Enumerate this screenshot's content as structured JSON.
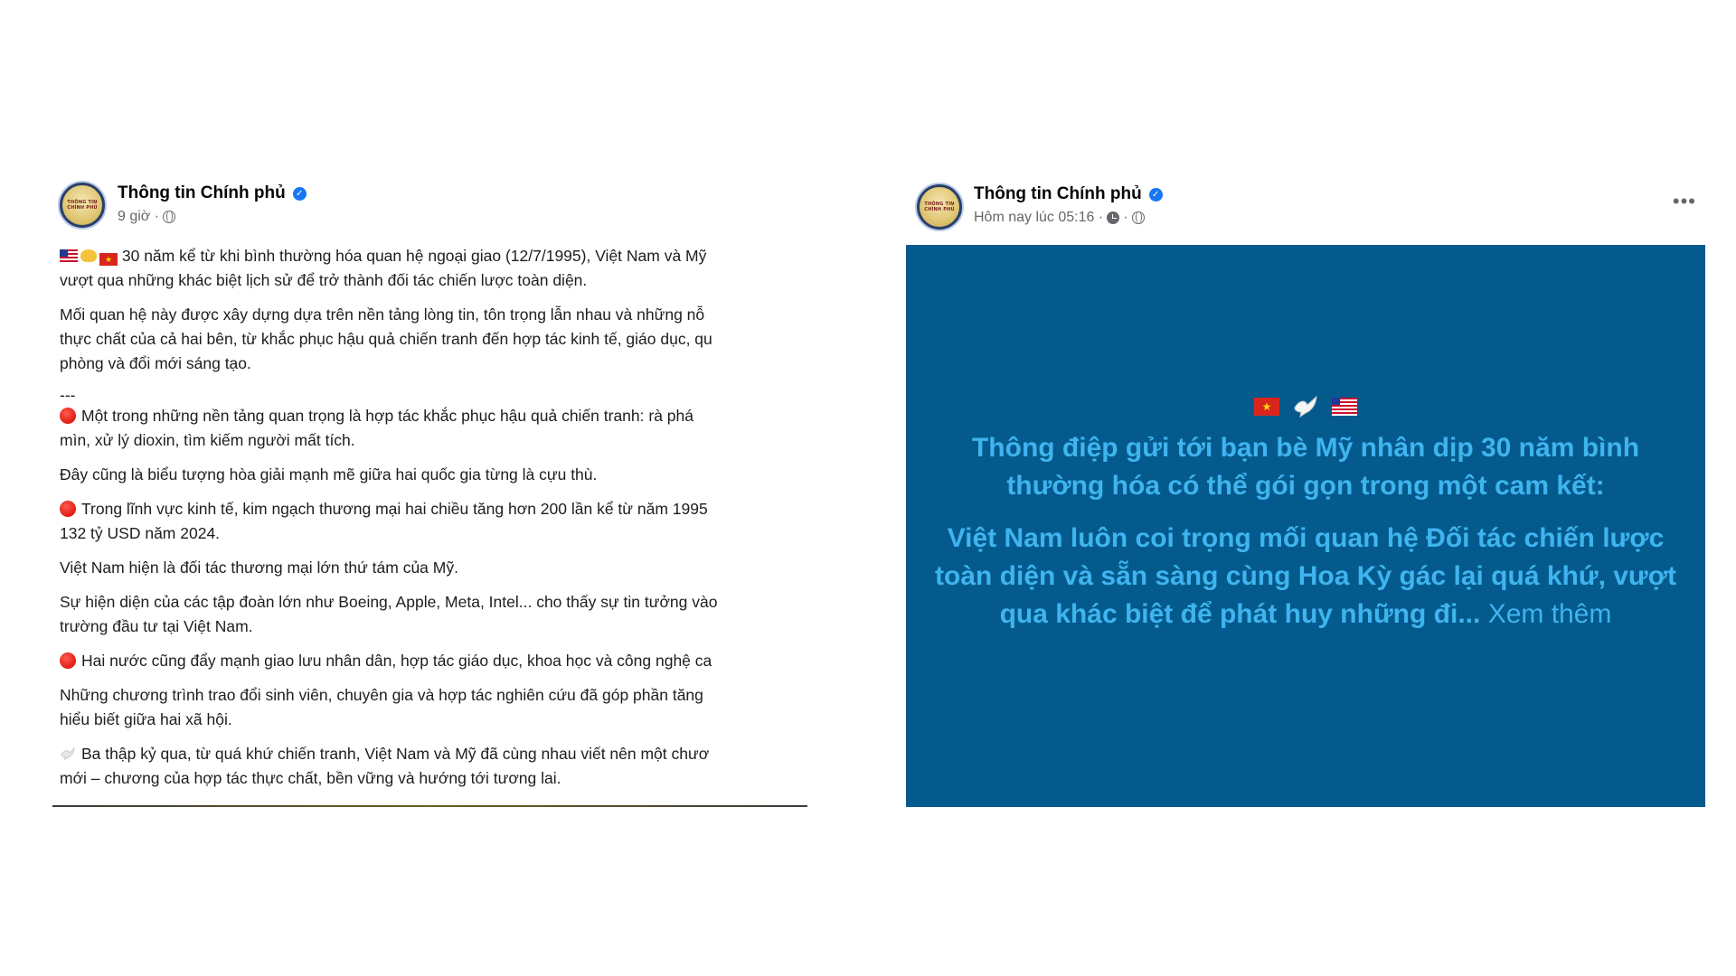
{
  "posts": [
    {
      "author": "Thông tin Chính phủ",
      "avatar_text": "THÔNG TIN CHÍNH PHỦ",
      "time": "9 giờ ·",
      "lines": {
        "l1": "30 năm kể từ khi bình thường hóa quan hệ ngoại giao (12/7/1995), Việt Nam và Mỹ",
        "l2": "vượt qua những khác biệt lịch sử để trở thành đối tác chiến lược toàn diện.",
        "l3": "Mối quan hệ này được xây dựng dựa trên nền tảng lòng tin, tôn trọng lẫn nhau và những nỗ",
        "l4": "thực chất của cả hai bên, từ khắc phục hậu quả chiến tranh đến hợp tác kinh tế, giáo dục, qu",
        "l5": "phòng và đổi mới sáng tạo.",
        "l6": "---",
        "l7": "Một trong những nền tảng quan trọng là hợp tác khắc phục hậu quả chiến tranh: rà phá",
        "l8": "mìn, xử lý dioxin, tìm kiếm người mất tích.",
        "l9": "Đây cũng là biểu tượng hòa giải mạnh mẽ giữa hai quốc gia từng là cựu thù.",
        "l10": "Trong lĩnh vực kinh tế, kim ngạch thương mại hai chiều tăng hơn 200 lần kể từ năm 1995",
        "l11": "132 tỷ USD năm 2024.",
        "l12": "Việt Nam hiện là đối tác thương mại lớn thứ tám của Mỹ.",
        "l13": "Sự hiện diện của các tập đoàn lớn như Boeing, Apple, Meta, Intel... cho thấy sự tin tưởng vào",
        "l14": "trường đầu tư tại Việt Nam.",
        "l15": "Hai nước cũng đẩy mạnh giao lưu nhân dân, hợp tác giáo dục, khoa học và công nghệ ca",
        "l16": "Những chương trình trao đổi sinh viên, chuyên gia và hợp tác nghiên cứu đã góp phần tăng",
        "l17": "hiểu biết giữa hai xã hội.",
        "l18": "Ba thập kỷ qua, từ quá khứ chiến tranh, Việt Nam và Mỹ đã cùng nhau viết nên một chươ",
        "l19": "mới – chương của hợp tác thực chất, bền vững và hướng tới tương lai."
      },
      "icons": [
        "us-flag",
        "handshake",
        "vietnam-flag",
        "red-circle",
        "dove",
        "globe"
      ]
    },
    {
      "author": "Thông tin Chính phủ",
      "avatar_text": "THÔNG TIN CHÍNH PHỦ",
      "time": "Hôm nay lúc 05:16 ·",
      "more": "•••",
      "card": {
        "background": "#045a8d",
        "text_color": "#3fb4ee",
        "para1": "Thông điệp gửi tới bạn bè Mỹ nhân dịp 30 năm bình thường hóa có thể gói gọn trong một cam kết:",
        "para2": "Việt Nam luôn coi trọng mối quan hệ Đối tác chiến lược toàn diện và sẵn sàng cùng Hoa Kỳ gác lại quá khứ, vượt qua khác biệt để phát huy những đi...",
        "see_more": "Xem thêm"
      },
      "icons": [
        "vietnam-flag",
        "dove",
        "us-flag",
        "clock",
        "globe",
        "more-options"
      ]
    }
  ]
}
